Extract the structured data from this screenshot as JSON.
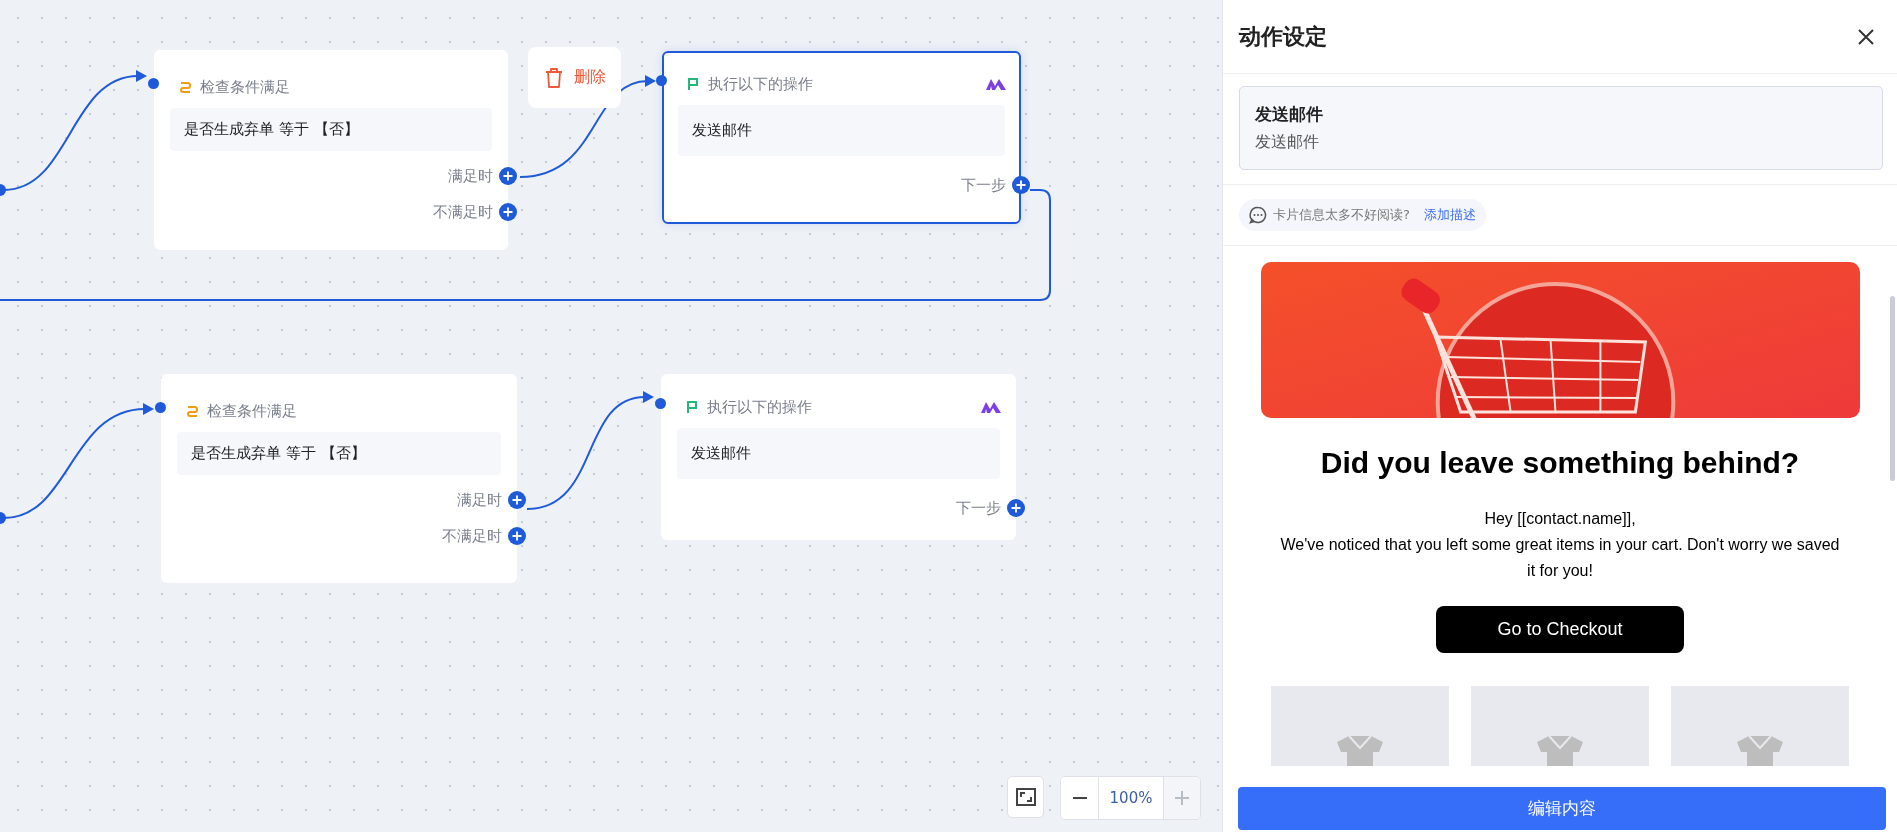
{
  "canvas": {
    "nodes": [
      {
        "kind": "condition",
        "title": "检查条件满足",
        "condition": "是否生成弃单 等于 【否】",
        "branches": [
          {
            "label": "满足时"
          },
          {
            "label": "不满足时"
          }
        ],
        "selected": false
      },
      {
        "kind": "action",
        "title": "执行以下的操作",
        "content": "发送邮件",
        "next_label": "下一步",
        "selected": true
      },
      {
        "kind": "condition",
        "title": "检查条件满足",
        "condition": "是否生成弃单 等于 【否】",
        "branches": [
          {
            "label": "满足时"
          },
          {
            "label": "不满足时"
          }
        ],
        "selected": false
      },
      {
        "kind": "action",
        "title": "执行以下的操作",
        "content": "发送邮件",
        "next_label": "下一步",
        "selected": false
      }
    ],
    "delete_button": {
      "label": "删除"
    },
    "zoom": {
      "value": "100%"
    }
  },
  "panel": {
    "title": "动作设定",
    "card": {
      "title": "发送邮件",
      "subtitle": "发送邮件"
    },
    "hint": {
      "text": "卡片信息太多不好阅读?",
      "link": "添加描述"
    },
    "email": {
      "heading": "Did you leave something behind?",
      "greeting": "Hey [[contact.name]],",
      "body": "We've noticed that you left some great items in your cart. Don't worry we saved it for you!",
      "button": "Go to Checkout"
    },
    "edit_button": "编辑内容"
  }
}
